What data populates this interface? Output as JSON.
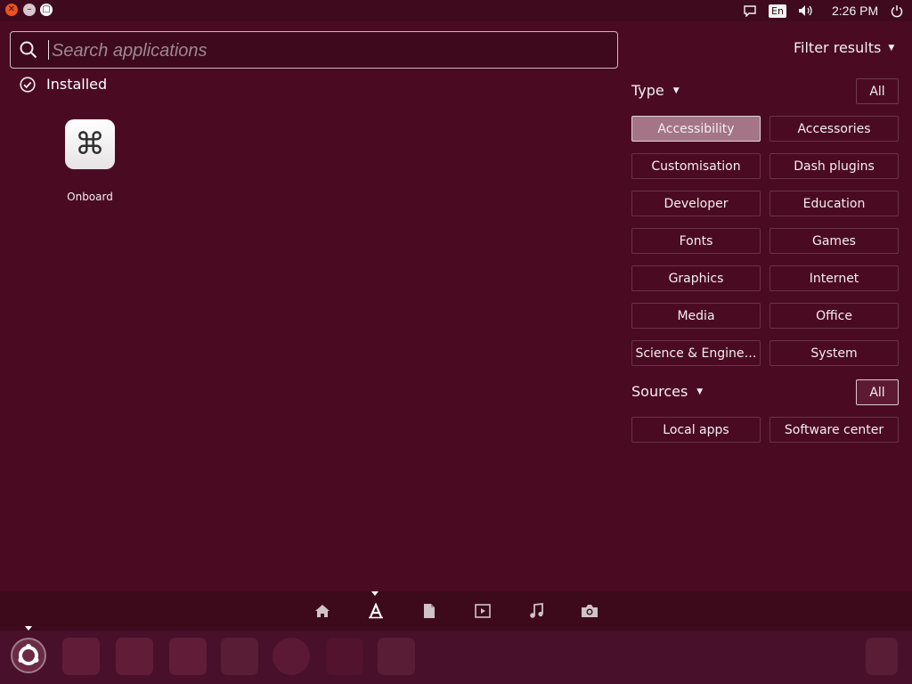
{
  "window": {
    "close_glyph": "✕",
    "minimize_glyph": "–",
    "maximize_glyph": "▢"
  },
  "panel": {
    "keyboard_layout": "En",
    "time": "2:26 PM",
    "icons": [
      "chat-icon",
      "volume-icon",
      "power-icon"
    ]
  },
  "search": {
    "placeholder": "Search applications",
    "value": ""
  },
  "filter_toggle_label": "Filter results",
  "installed": {
    "heading": "Installed",
    "apps": [
      {
        "name": "Onboard",
        "icon": "command-key-icon",
        "glyph": "⌘"
      }
    ]
  },
  "filters": {
    "type_heading": "Type",
    "type_all": "All",
    "types": [
      "Accessibility",
      "Accessories",
      "Customisation",
      "Dash plugins",
      "Developer",
      "Education",
      "Fonts",
      "Games",
      "Graphics",
      "Internet",
      "Media",
      "Office",
      "Science & Engine…",
      "System"
    ],
    "selected_type": "Accessibility",
    "sources_heading": "Sources",
    "sources_all": "All",
    "sources": [
      "Local apps",
      "Software center"
    ]
  },
  "lenses": [
    "home-icon",
    "applications-icon",
    "files-icon",
    "video-icon",
    "music-icon",
    "photos-icon"
  ],
  "active_lens": "applications-icon",
  "launcher": [
    "ubuntu-dash-icon",
    "writer-icon",
    "calc-icon",
    "impress-icon",
    "clock-icon",
    "firefox-icon",
    "blank-icon",
    "settings-icon",
    "trash-icon"
  ],
  "colors": {
    "background": "#4a0b22",
    "selected_filter": "#a47487",
    "accent": "#e95420"
  }
}
